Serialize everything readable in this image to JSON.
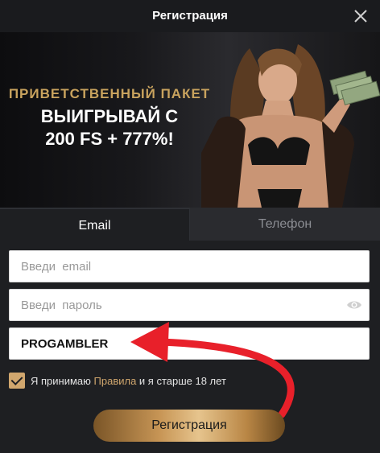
{
  "header": {
    "title": "Регистрация"
  },
  "banner": {
    "line1": "ПРИВЕТСТВЕННЫЙ ПАКЕТ",
    "line2": "ВЫИГРЫВАЙ С",
    "line3": "200 FS + 777%!"
  },
  "tabs": [
    {
      "label": "Email",
      "active": true
    },
    {
      "label": "Телефон",
      "active": false
    }
  ],
  "form": {
    "email_placeholder": "Введи  email",
    "password_placeholder": "Введи  пароль",
    "promo_value": "PROGAMBLER"
  },
  "terms": {
    "prefix": "Я принимаю ",
    "link": "Правила",
    "suffix": " и я старше 18 лет",
    "checked": true
  },
  "submit_label": "Регистрация",
  "colors": {
    "accent": "#d1a76e",
    "arrow": "#e8202a",
    "background": "#1e1f22"
  }
}
